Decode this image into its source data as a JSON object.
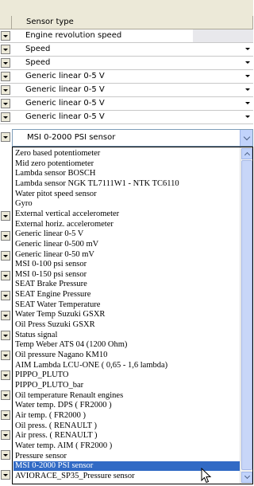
{
  "header": {
    "column_title": "Sensor type"
  },
  "rows": [
    {
      "value": "Engine revolution speed"
    },
    {
      "value": "Speed"
    },
    {
      "value": "Speed"
    },
    {
      "value": "Generic linear 0-5 V"
    },
    {
      "value": "Generic linear 0-5 V"
    },
    {
      "value": "Generic linear 0-5 V"
    },
    {
      "value": "Generic linear 0-5 V"
    }
  ],
  "combo": {
    "value": "MSI 0-2000 PSI sensor"
  },
  "dropdown": {
    "options": [
      "Zero based potentiometer",
      "Mid zero potentiometer",
      "Lambda sensor BOSCH",
      "Lambda sensor NGK TL7111W1 - NTK TC6110",
      "Water pitot speed sensor",
      "Gyro",
      "External vertical accelerometer",
      "External horiz. accelerometer",
      "Generic linear 0-5 V",
      "Generic linear 0-500 mV",
      "Generic linear 0-50 mV",
      "MSI 0-100 psi sensor",
      "MSI 0-150 psi sensor",
      "SEAT Brake Pressure",
      "SEAT Engine Pressure",
      "SEAT Water Temperature",
      "Water Temp Suzuki GSXR",
      "Oil Press Suzuki GSXR",
      "Status signal",
      "Temp Weber ATS 04 (1200 Ohm)",
      "Oil pressure Nagano KM10",
      "AIM Lambda LCU-ONE ( 0,65 - 1,6 lambda)",
      "PIPPO_PLUTO",
      "PIPPO_PLUTO_bar",
      "Oil temperature Renault engines",
      "Water temp. DPS ( FR2000 )",
      "Air temp. ( FR2000 )",
      "Oil press. ( RENAULT )",
      "Air press. ( RENAULT )",
      "Water temp. AIM ( FR2000 )",
      "Pressure sensor",
      "MSI 0-2000 PSI sensor",
      "AVIORACE_SP35_Pressure sensor"
    ],
    "selected": "MSI 0-2000 PSI sensor"
  },
  "icons": {
    "row_button": "dropdown-arrow-icon",
    "combo_button": "chevron-down-icon",
    "scroll_up": "chevron-up-icon",
    "scroll_down": "chevron-down-icon",
    "pointer": "mouse-cursor-icon"
  },
  "colors": {
    "selection": "#316ac5",
    "header_bg": "#ece9d8",
    "combo_button": "#c1d3fb"
  }
}
